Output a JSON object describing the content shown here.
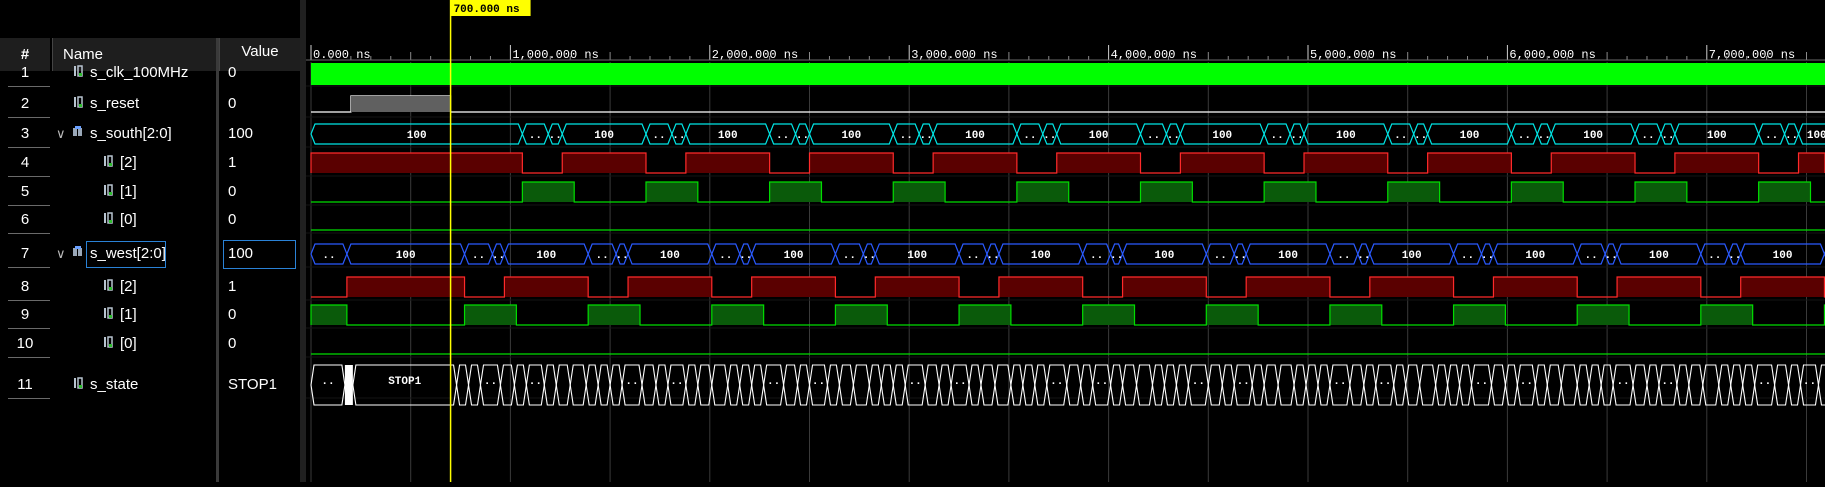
{
  "header": {
    "num": "#",
    "name": "Name",
    "value": "Value"
  },
  "cursor": {
    "label": "700.000 ns",
    "time_ns": 700
  },
  "timeline": {
    "ticks": [
      {
        "t": 0,
        "label": "0.000 ns"
      },
      {
        "t": 1000,
        "label": "1,000.000 ns"
      },
      {
        "t": 2000,
        "label": "2,000.000 ns"
      },
      {
        "t": 3000,
        "label": "3,000.000 ns"
      },
      {
        "t": 4000,
        "label": "4,000.000 ns"
      },
      {
        "t": 5000,
        "label": "5,000.000 ns"
      },
      {
        "t": 6000,
        "label": "6,000.000 ns"
      },
      {
        "t": 7000,
        "label": "7,000.000 ns"
      }
    ]
  },
  "signals": [
    {
      "num": "1",
      "name": "s_clk_100MHz",
      "value": "0",
      "kind": "clock",
      "icon": "signal-icon"
    },
    {
      "num": "2",
      "name": "s_reset",
      "value": "0",
      "kind": "reset",
      "icon": "signal-icon"
    },
    {
      "num": "3",
      "name": "s_south[2:0]",
      "value": "100",
      "kind": "bus",
      "icon": "bus-icon",
      "expanded": true
    },
    {
      "num": "4",
      "name": "[2]",
      "value": "1",
      "kind": "bit",
      "icon": "signal-icon"
    },
    {
      "num": "5",
      "name": "[1]",
      "value": "0",
      "kind": "bit",
      "icon": "signal-icon"
    },
    {
      "num": "6",
      "name": "[0]",
      "value": "0",
      "kind": "bit",
      "icon": "signal-icon"
    },
    {
      "num": "7",
      "name": "s_west[2:0]",
      "value": "100",
      "kind": "bus",
      "icon": "bus-icon",
      "expanded": true,
      "selected": true
    },
    {
      "num": "8",
      "name": "[2]",
      "value": "1",
      "kind": "bit",
      "icon": "signal-icon"
    },
    {
      "num": "9",
      "name": "[1]",
      "value": "0",
      "kind": "bit",
      "icon": "signal-icon"
    },
    {
      "num": "10",
      "name": "[0]",
      "value": "0",
      "kind": "bit",
      "icon": "signal-icon"
    },
    {
      "num": "11",
      "name": "s_state",
      "value": "STOP1",
      "kind": "state",
      "icon": "signal-icon"
    }
  ],
  "bus_labels": {
    "long": "100",
    "short": "..",
    "state_long": "STOP1"
  },
  "colors": {
    "clock": "#00ff00",
    "bit_high": "#ff2a2a",
    "bit_high_fill": "#5a0000",
    "bit_one": "#00dd00",
    "bit_one_fill": "#0a5a0a",
    "bus_south": "#00e5e5",
    "bus_west": "#2a5aff",
    "cursor": "#ffff00"
  }
}
